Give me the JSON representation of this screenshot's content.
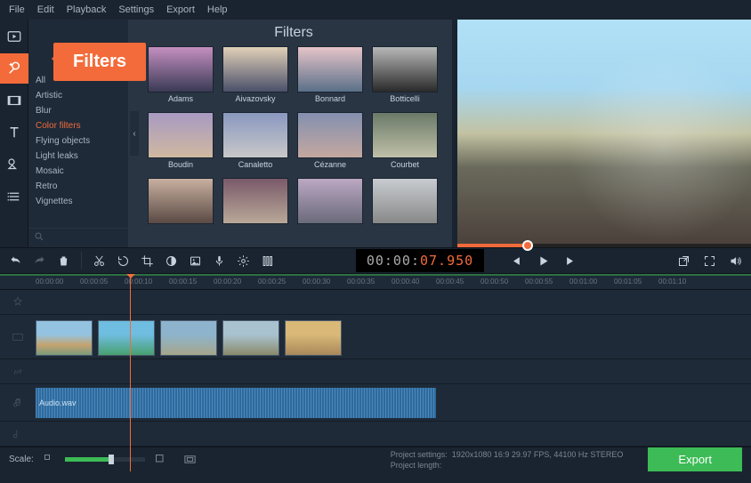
{
  "menu": {
    "file": "File",
    "edit": "Edit",
    "playback": "Playback",
    "settings": "Settings",
    "export": "Export",
    "help": "Help"
  },
  "callout": "Filters",
  "panel_title": "Filters",
  "categories": [
    "All",
    "Artistic",
    "Blur",
    "Color filters",
    "Flying objects",
    "Light leaks",
    "Mosaic",
    "Retro",
    "Vignettes"
  ],
  "active_category_index": 3,
  "filters": [
    "Adams",
    "Aivazovsky",
    "Bonnard",
    "Botticelli",
    "Boudin",
    "Canaletto",
    "Cézanne",
    "Courbet",
    "",
    "",
    "",
    ""
  ],
  "timecode": {
    "hms": "00:00:",
    "current": "07.950"
  },
  "ruler": [
    "00:00:00",
    "00:00:05",
    "00:00:10",
    "00:00:15",
    "00:00:20",
    "00:00:25",
    "00:00:30",
    "00:00:35",
    "00:00:40",
    "00:00:45",
    "00:00:50",
    "00:00:55",
    "00:01:00",
    "00:01:05",
    "00:01:10"
  ],
  "audio_clip": "Audio.wav",
  "footer": {
    "scale_label": "Scale:",
    "project_settings": "Project settings:",
    "settings_value": "1920x1080 16:9 29.97 FPS, 44100 Hz STEREO",
    "project_length": "Project length:",
    "export": "Export"
  }
}
